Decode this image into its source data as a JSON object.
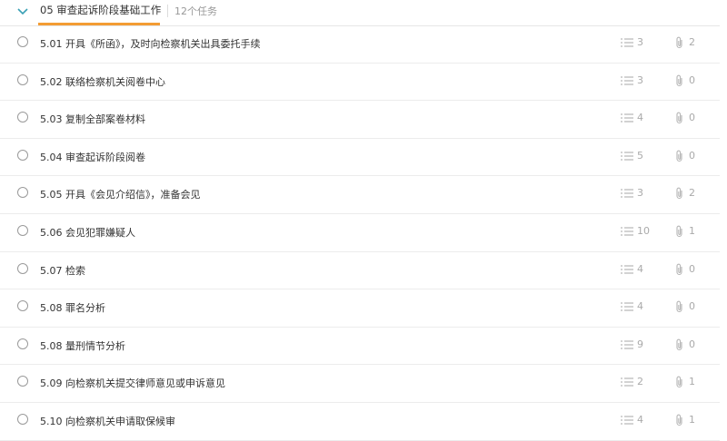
{
  "group": {
    "title": "05 审查起诉阶段基础工作",
    "count_label": "12个任务"
  },
  "colors": {
    "accent": "#f39c33",
    "chevron": "#3aa0b5"
  },
  "tasks": [
    {
      "label": "5.01 开具《所函》，及时向检察机关出具委托手续",
      "subtasks": "3",
      "attachments": "2"
    },
    {
      "label": "5.02 联络检察机关阅卷中心",
      "subtasks": "3",
      "attachments": "0"
    },
    {
      "label": "5.03 复制全部案卷材料",
      "subtasks": "4",
      "attachments": "0"
    },
    {
      "label": "5.04 审查起诉阶段阅卷",
      "subtasks": "5",
      "attachments": "0"
    },
    {
      "label": "5.05 开具《会见介绍信》，准备会见",
      "subtasks": "3",
      "attachments": "2"
    },
    {
      "label": "5.06 会见犯罪嫌疑人",
      "subtasks": "10",
      "attachments": "1"
    },
    {
      "label": "5.07 检索",
      "subtasks": "4",
      "attachments": "0"
    },
    {
      "label": "5.08 罪名分析",
      "subtasks": "4",
      "attachments": "0"
    },
    {
      "label": "5.08 量刑情节分析",
      "subtasks": "9",
      "attachments": "0"
    },
    {
      "label": "5.09 向检察机关提交律师意见或申诉意见",
      "subtasks": "2",
      "attachments": "1"
    },
    {
      "label": "5.10 向检察机关申请取保候审",
      "subtasks": "4",
      "attachments": "1"
    }
  ]
}
